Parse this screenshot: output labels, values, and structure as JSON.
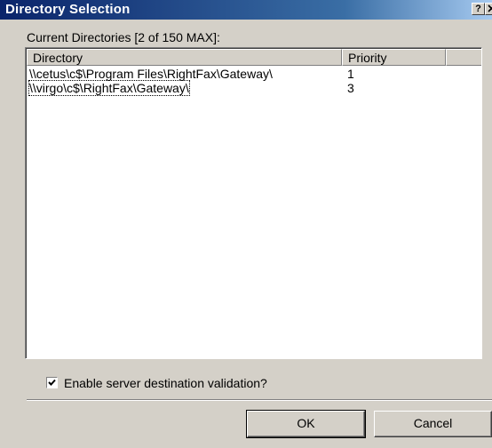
{
  "window": {
    "title": "Directory Selection",
    "help_label": "?",
    "close_label": "✕"
  },
  "label": "Current Directories [2 of 150 MAX]:",
  "list": {
    "columns": [
      "Directory",
      "Priority"
    ],
    "rows": [
      {
        "directory": "\\\\cetus\\c$\\Program Files\\RightFax\\Gateway\\",
        "priority": "1"
      },
      {
        "directory": "\\\\virgo\\c$\\RightFax\\Gateway\\",
        "priority": "3"
      }
    ]
  },
  "checkbox": {
    "label": "Enable server destination validation?",
    "checked": true
  },
  "buttons": {
    "ok": "OK",
    "cancel": "Cancel"
  }
}
